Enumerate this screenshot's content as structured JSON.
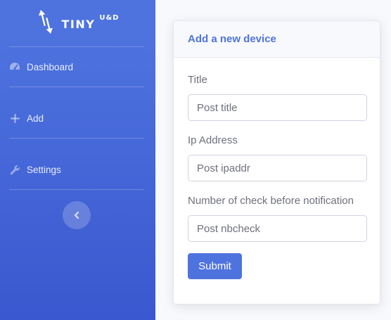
{
  "brand": {
    "name": "TINY",
    "superscript": "U&D",
    "icon": "up-down-arrows-icon"
  },
  "sidebar": {
    "items": [
      {
        "label": "Dashboard",
        "icon": "tachometer-icon"
      },
      {
        "label": "Add",
        "icon": "plus-icon"
      },
      {
        "label": "Settings",
        "icon": "wrench-icon"
      }
    ],
    "toggle_icon": "chevron-left-icon"
  },
  "form": {
    "title": "Add a new device",
    "fields": [
      {
        "label": "Title",
        "placeholder": "Post title",
        "value": ""
      },
      {
        "label": "Ip Address",
        "placeholder": "Post ipaddr",
        "value": ""
      },
      {
        "label": "Number of check before notification",
        "placeholder": "Post nbcheck",
        "value": ""
      }
    ],
    "submit_label": "Submit"
  },
  "colors": {
    "primary": "#4e73df",
    "sidebar_gradient_end": "#3a58cf",
    "page_background": "#f8f9fc",
    "text_muted": "#6e707e"
  }
}
